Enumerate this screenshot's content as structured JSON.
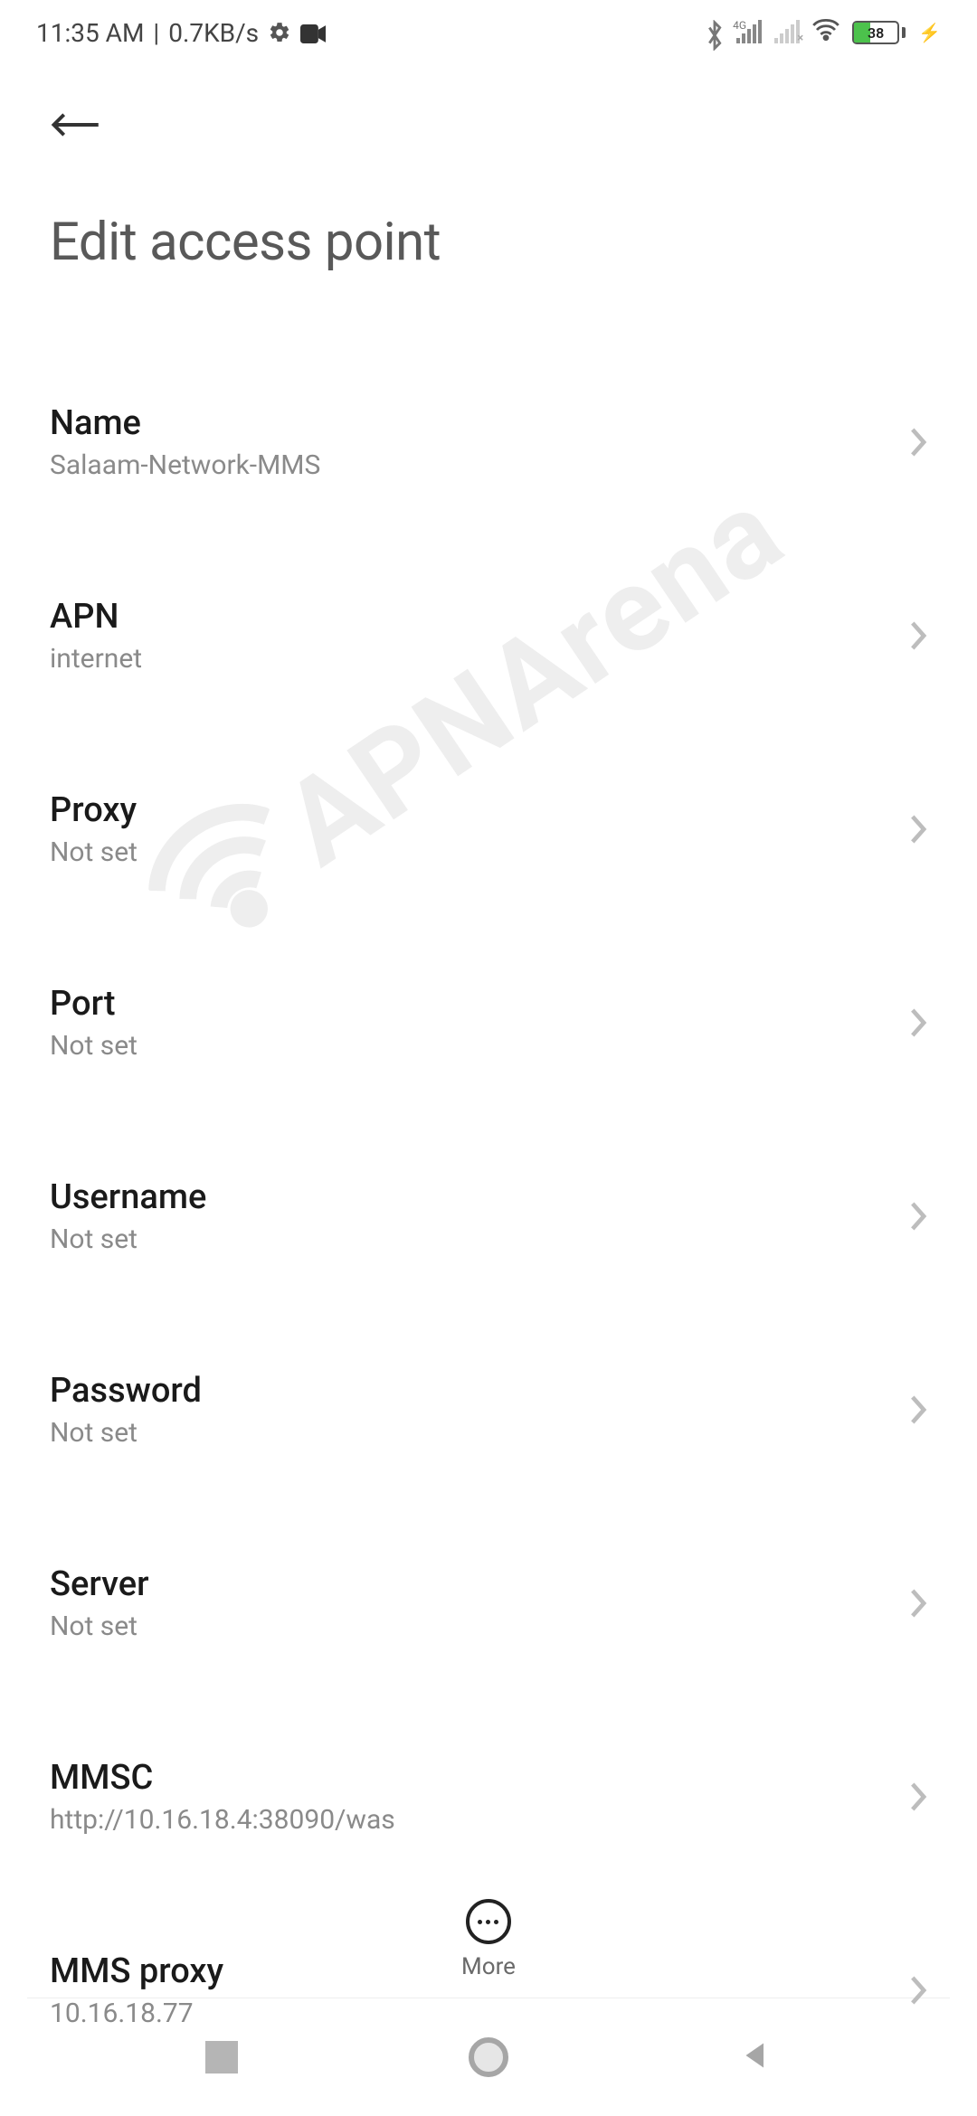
{
  "status_bar": {
    "time": "11:35 AM",
    "speed": "0.7KB/s",
    "network_label": "4G",
    "battery_percent": "38"
  },
  "header": {
    "title": "Edit access point"
  },
  "items": [
    {
      "title": "Name",
      "subtitle": "Salaam-Network-MMS"
    },
    {
      "title": "APN",
      "subtitle": "internet"
    },
    {
      "title": "Proxy",
      "subtitle": "Not set"
    },
    {
      "title": "Port",
      "subtitle": "Not set"
    },
    {
      "title": "Username",
      "subtitle": "Not set"
    },
    {
      "title": "Password",
      "subtitle": "Not set"
    },
    {
      "title": "Server",
      "subtitle": "Not set"
    },
    {
      "title": "MMSC",
      "subtitle": "http://10.16.18.4:38090/was"
    },
    {
      "title": "MMS proxy",
      "subtitle": "10.16.18.77"
    }
  ],
  "bottom": {
    "more_label": "More"
  },
  "watermark": "APNArena"
}
